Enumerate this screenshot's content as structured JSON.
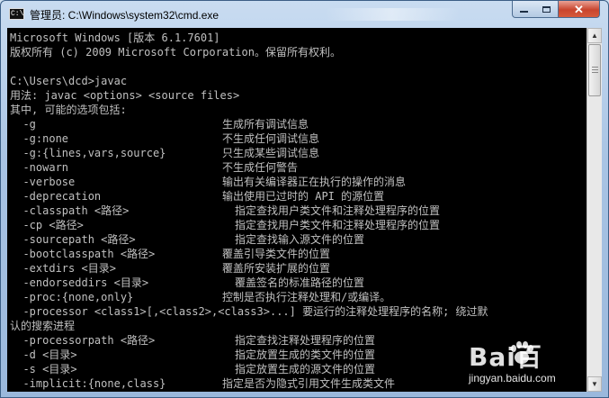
{
  "window": {
    "title": "管理员: C:\\Windows\\system32\\cmd.exe",
    "icon": "cmd-icon",
    "icon_text": "C:\\",
    "controls": {
      "minimize": "minimize-icon",
      "maximize": "maximize-icon",
      "close": "close-icon",
      "close_glyph": "✕"
    }
  },
  "console": {
    "lines": [
      "Microsoft Windows [版本 6.1.7601]",
      "版权所有 (c) 2009 Microsoft Corporation。保留所有权利。",
      "",
      "C:\\Users\\dcd>javac",
      "用法: javac <options> <source files>",
      "其中, 可能的选项包括:"
    ],
    "options": [
      {
        "opt": "  -g",
        "desc": "生成所有调试信息"
      },
      {
        "opt": "  -g:none",
        "desc": "不生成任何调试信息"
      },
      {
        "opt": "  -g:{lines,vars,source}",
        "desc": "只生成某些调试信息"
      },
      {
        "opt": "  -nowarn",
        "desc": "不生成任何警告"
      },
      {
        "opt": "  -verbose",
        "desc": "输出有关编译器正在执行的操作的消息"
      },
      {
        "opt": "  -deprecation",
        "desc": "输出使用已过时的 API 的源位置"
      },
      {
        "opt": "  -classpath <路径>",
        "desc": "指定查找用户类文件和注释处理程序的位置"
      },
      {
        "opt": "  -cp <路径>",
        "desc": "指定查找用户类文件和注释处理程序的位置"
      },
      {
        "opt": "  -sourcepath <路径>",
        "desc": "指定查找输入源文件的位置"
      },
      {
        "opt": "  -bootclasspath <路径>",
        "desc": "覆盖引导类文件的位置"
      },
      {
        "opt": "  -extdirs <目录>",
        "desc": "覆盖所安装扩展的位置"
      },
      {
        "opt": "  -endorseddirs <目录>",
        "desc": "覆盖签名的标准路径的位置"
      },
      {
        "opt": "  -proc:{none,only}",
        "desc": "控制是否执行注释处理和/或编译。"
      }
    ],
    "processor_line_1": "  -processor <class1>[,<class2>,<class3>...] 要运行的注释处理程序的名称; 绕过默",
    "processor_line_2": "认的搜索进程",
    "options2": [
      {
        "opt": "  -processorpath <路径>",
        "desc": "指定查找注释处理程序的位置"
      },
      {
        "opt": "  -d <目录>",
        "desc": "指定放置生成的类文件的位置"
      },
      {
        "opt": "  -s <目录>",
        "desc": "指定放置生成的源文件的位置"
      },
      {
        "opt": "  -implicit:{none,class}",
        "desc": "指定是否为隐式引用文件生成类文件"
      }
    ]
  },
  "scrollbar": {
    "up": "▲",
    "down": "▼"
  },
  "watermark": {
    "logo": "Bai百",
    "url": "jingyan.baidu.com"
  }
}
